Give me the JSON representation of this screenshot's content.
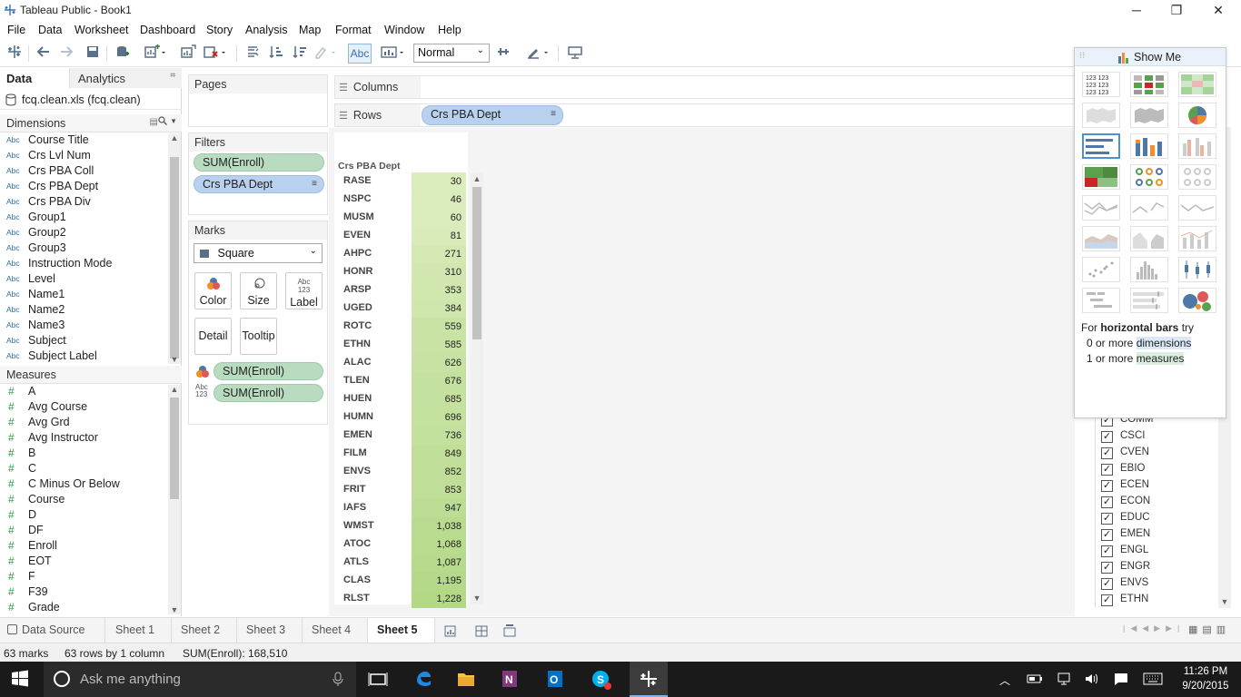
{
  "window": {
    "title": "Tableau Public - Book1",
    "minimize": "─",
    "restore": "❐",
    "close": "✕"
  },
  "menu": [
    "File",
    "Data",
    "Worksheet",
    "Dashboard",
    "Story",
    "Analysis",
    "Map",
    "Format",
    "Window",
    "Help"
  ],
  "toolbar": {
    "label_button": "Abc",
    "fit_value": "Normal"
  },
  "data_pane": {
    "tab_data": "Data",
    "tab_analytics": "Analytics",
    "datasource": "fcq.clean.xls (fcq.clean)",
    "dimensions_label": "Dimensions",
    "dimensions": [
      "Course Title",
      "Crs Lvl Num",
      "Crs PBA Coll",
      "Crs PBA Dept",
      "Crs PBA Div",
      "Group1",
      "Group2",
      "Group3",
      "Instruction Mode",
      "Level",
      "Name1",
      "Name2",
      "Name3",
      "Subject",
      "Subject Label"
    ],
    "measures_label": "Measures",
    "measures": [
      "A",
      "Avg Course",
      "Avg Grd",
      "Avg Instructor",
      "B",
      "C",
      "C Minus Or Below",
      "Course",
      "D",
      "DF",
      "Enroll",
      "EOT",
      "F",
      "F39",
      "Grade"
    ],
    "type_abc": "Abc",
    "type_hash": "#"
  },
  "shelves": {
    "pages": "Pages",
    "filters": "Filters",
    "filter_pills": [
      "SUM(Enroll)",
      "Crs PBA Dept"
    ],
    "marks": "Marks",
    "mark_type": "Square",
    "mark_buttons": [
      "Color",
      "Size",
      "Label",
      "Detail",
      "Tooltip"
    ],
    "mark_pills": [
      "SUM(Enroll)",
      "SUM(Enroll)"
    ],
    "columns": "Columns",
    "rows": "Rows",
    "rows_pill": "Crs PBA Dept"
  },
  "viz": {
    "header": "Crs PBA Dept",
    "rows": [
      {
        "dept": "RASE",
        "value": "30"
      },
      {
        "dept": "NSPC",
        "value": "46"
      },
      {
        "dept": "MUSM",
        "value": "60"
      },
      {
        "dept": "EVEN",
        "value": "81"
      },
      {
        "dept": "AHPC",
        "value": "271"
      },
      {
        "dept": "HONR",
        "value": "310"
      },
      {
        "dept": "ARSP",
        "value": "353"
      },
      {
        "dept": "UGED",
        "value": "384"
      },
      {
        "dept": "ROTC",
        "value": "559"
      },
      {
        "dept": "ETHN",
        "value": "585"
      },
      {
        "dept": "ALAC",
        "value": "626"
      },
      {
        "dept": "TLEN",
        "value": "676"
      },
      {
        "dept": "HUEN",
        "value": "685"
      },
      {
        "dept": "HUMN",
        "value": "696"
      },
      {
        "dept": "EMEN",
        "value": "736"
      },
      {
        "dept": "FILM",
        "value": "849"
      },
      {
        "dept": "ENVS",
        "value": "852"
      },
      {
        "dept": "FRIT",
        "value": "853"
      },
      {
        "dept": "IAFS",
        "value": "947"
      },
      {
        "dept": "WMST",
        "value": "1,038"
      },
      {
        "dept": "ATOC",
        "value": "1,068"
      },
      {
        "dept": "ATLS",
        "value": "1,087"
      },
      {
        "dept": "CLAS",
        "value": "1,195"
      },
      {
        "dept": "RLST",
        "value": "1,228"
      }
    ],
    "color_low": "#dbecbd",
    "color_high": "#b3d886"
  },
  "filter_card": {
    "items": [
      "COMM",
      "CSCI",
      "CVEN",
      "EBIO",
      "ECEN",
      "ECON",
      "EDUC",
      "EMEN",
      "ENGL",
      "ENGR",
      "ENVS",
      "ETHN"
    ],
    "check": "✓"
  },
  "show_me": {
    "title": "Show Me",
    "hint_prefix": "For ",
    "hint_bold": "horizontal bars",
    "hint_suffix": " try",
    "req1_count": "0 or more ",
    "req1_word": "dimensions",
    "req2_count": "1 or more ",
    "req2_word": "measures"
  },
  "sheet_tabs": {
    "datasource": "Data Source",
    "sheets": [
      "Sheet 1",
      "Sheet 2",
      "Sheet 3",
      "Sheet 4",
      "Sheet 5"
    ],
    "active": "Sheet 5"
  },
  "status": {
    "marks": "63 marks",
    "dims": "63 rows by 1 column",
    "sum": "SUM(Enroll): 168,510"
  },
  "taskbar": {
    "search_placeholder": "Ask me anything",
    "time": "11:26 PM",
    "date": "9/20/2015"
  }
}
